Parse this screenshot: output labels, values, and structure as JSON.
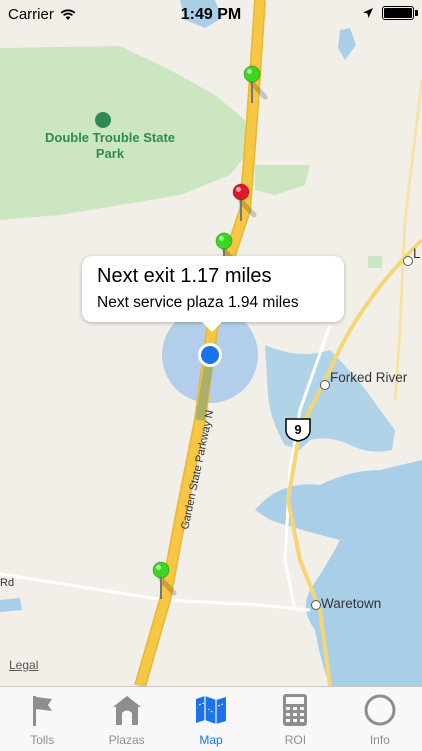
{
  "status_bar": {
    "carrier": "Carrier",
    "time": "1:49 PM"
  },
  "map": {
    "park_name": "Double Trouble State Park",
    "places": {
      "forked_river": "Forked River",
      "waretown": "Waretown",
      "edge_label": "L"
    },
    "road_labels": {
      "parkway": "Garden State Parkway N",
      "rd_fragment": "Rd"
    },
    "route_shield": "9",
    "legal": "Legal",
    "pins": [
      {
        "color": "#39d81c",
        "status": "green"
      },
      {
        "color": "#e0182a",
        "status": "red"
      },
      {
        "color": "#39d81c",
        "status": "green"
      },
      {
        "color": "#39d81c",
        "status": "green"
      }
    ]
  },
  "callout": {
    "next_exit": "Next exit 1.17 miles",
    "next_service_plaza": "Next service plaza 1.94 miles"
  },
  "tabs": [
    {
      "label": "Tolls",
      "icon": "flag-icon",
      "active": false
    },
    {
      "label": "Plazas",
      "icon": "house-icon",
      "active": false
    },
    {
      "label": "Map",
      "icon": "map-icon",
      "active": true
    },
    {
      "label": "ROI",
      "icon": "calculator-icon",
      "active": false
    },
    {
      "label": "Info",
      "icon": "circle-icon",
      "active": false
    }
  ],
  "colors": {
    "accent": "#1a73e8",
    "road": "#f6c744",
    "water": "#a9cfe8",
    "park": "#cbe6c1"
  }
}
